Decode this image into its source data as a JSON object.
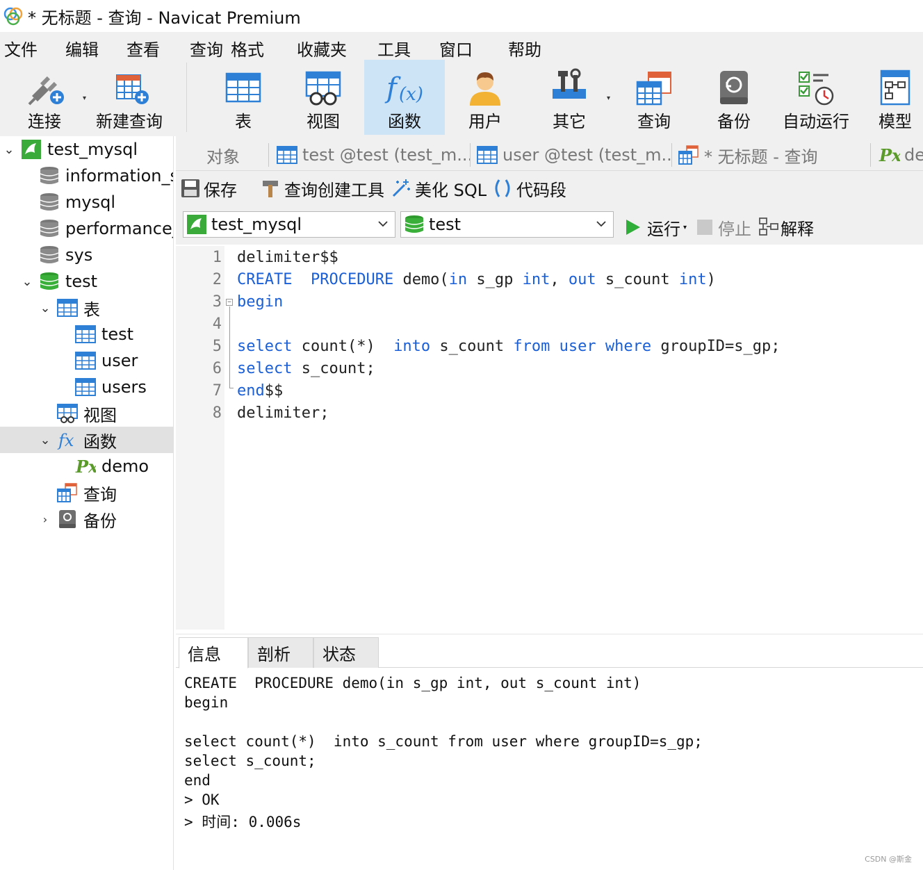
{
  "window": {
    "title": "* 无标题 - 查询 - Navicat Premium"
  },
  "menu": {
    "items": [
      "文件",
      "编辑",
      "查看",
      "查询",
      "格式",
      "收藏夹",
      "工具",
      "窗口",
      "帮助"
    ]
  },
  "toolbar": {
    "buttons": [
      {
        "label": "连接",
        "icon": "plug-icon"
      },
      {
        "label": "新建查询",
        "icon": "new-query-icon"
      },
      {
        "label": "表",
        "icon": "table-icon"
      },
      {
        "label": "视图",
        "icon": "view-icon"
      },
      {
        "label": "函数",
        "icon": "function-icon",
        "active": true
      },
      {
        "label": "用户",
        "icon": "user-icon"
      },
      {
        "label": "其它",
        "icon": "tools-icon"
      },
      {
        "label": "查询",
        "icon": "query-icon"
      },
      {
        "label": "备份",
        "icon": "backup-icon"
      },
      {
        "label": "自动运行",
        "icon": "schedule-icon"
      },
      {
        "label": "模型",
        "icon": "model-icon"
      }
    ]
  },
  "sidebar": {
    "connection": "test_mysql",
    "databases": [
      "information_s",
      "mysql",
      "performance_",
      "sys",
      "test"
    ],
    "test_children": {
      "tables_label": "表",
      "tables": [
        "test",
        "user",
        "users"
      ],
      "views_label": "视图",
      "functions_label": "函数",
      "functions": [
        "demo"
      ],
      "queries_label": "查询",
      "backups_label": "备份"
    }
  },
  "tabs": [
    {
      "label": "对象"
    },
    {
      "label": "test @test (test_m..."
    },
    {
      "label": "user @test (test_m..."
    },
    {
      "label": "* 无标题 - 查询"
    },
    {
      "label": "de"
    }
  ],
  "query_toolbar": {
    "save": "保存",
    "builder": "查询创建工具",
    "beautify": "美化 SQL",
    "snippet": "代码段"
  },
  "selectors": {
    "connection": "test_mysql",
    "database": "test",
    "run": "运行",
    "stop": "停止",
    "explain": "解释"
  },
  "editor": {
    "line_numbers": [
      "1",
      "2",
      "3",
      "4",
      "5",
      "6",
      "7",
      "8"
    ]
  },
  "result_tabs": [
    "信息",
    "剖析",
    "状态"
  ],
  "messages": [
    "CREATE  PROCEDURE demo(in s_gp int, out s_count int)",
    "begin",
    "",
    "select count(*)  into s_count from user where groupID=s_gp;",
    "select s_count;",
    "end",
    "> OK",
    "> 时间: 0.006s"
  ],
  "watermark": "CSDN @斯金",
  "colors": {
    "keyword": "#1a5fd6",
    "active_toolbar": "#cde4f7",
    "selected_row": "#e1e1e1"
  }
}
